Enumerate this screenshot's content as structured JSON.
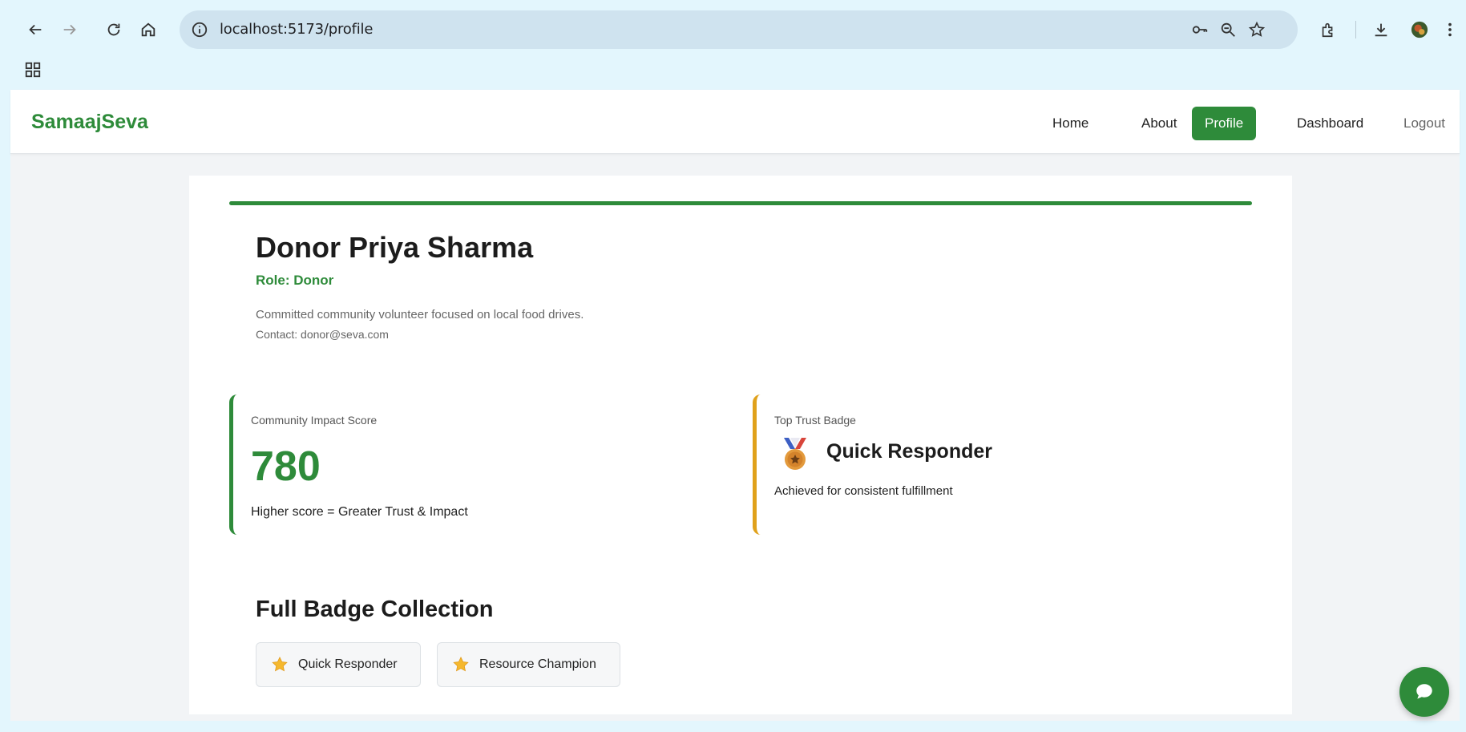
{
  "browser": {
    "url": "localhost:5173/profile",
    "icons": [
      "back-icon",
      "forward-icon",
      "reload-icon",
      "home-icon",
      "info-icon",
      "key-icon",
      "zoom-icon",
      "star-icon",
      "extensions-icon",
      "download-icon",
      "avatar",
      "menu-icon",
      "apps-icon"
    ]
  },
  "navbar": {
    "brand": "SamaajSeva",
    "links": [
      {
        "label": "Home"
      },
      {
        "label": "About"
      },
      {
        "label": "Profile",
        "active": true
      },
      {
        "label": "Dashboard"
      },
      {
        "label": "Logout"
      }
    ]
  },
  "profile": {
    "name": "Donor Priya Sharma",
    "role": "Role: Donor",
    "bio": "Committed community volunteer focused on local food drives.",
    "contact": "Contact: donor@seva.com"
  },
  "impact": {
    "label": "Community Impact Score",
    "score": "780",
    "note": "Higher score = Greater Trust & Impact"
  },
  "top_badge": {
    "label": "Top Trust Badge",
    "icon": "medal-icon",
    "title": "Quick Responder",
    "note": "Achieved for consistent fulfillment"
  },
  "badges": {
    "title": "Full Badge Collection",
    "items": [
      {
        "icon": "star-icon",
        "label": "Quick Responder"
      },
      {
        "icon": "star-icon",
        "label": "Resource Champion"
      }
    ]
  },
  "colors": {
    "brand": "#2e8b3a",
    "badge_accent": "#e0a11b",
    "frame": "#e3f6fd"
  }
}
